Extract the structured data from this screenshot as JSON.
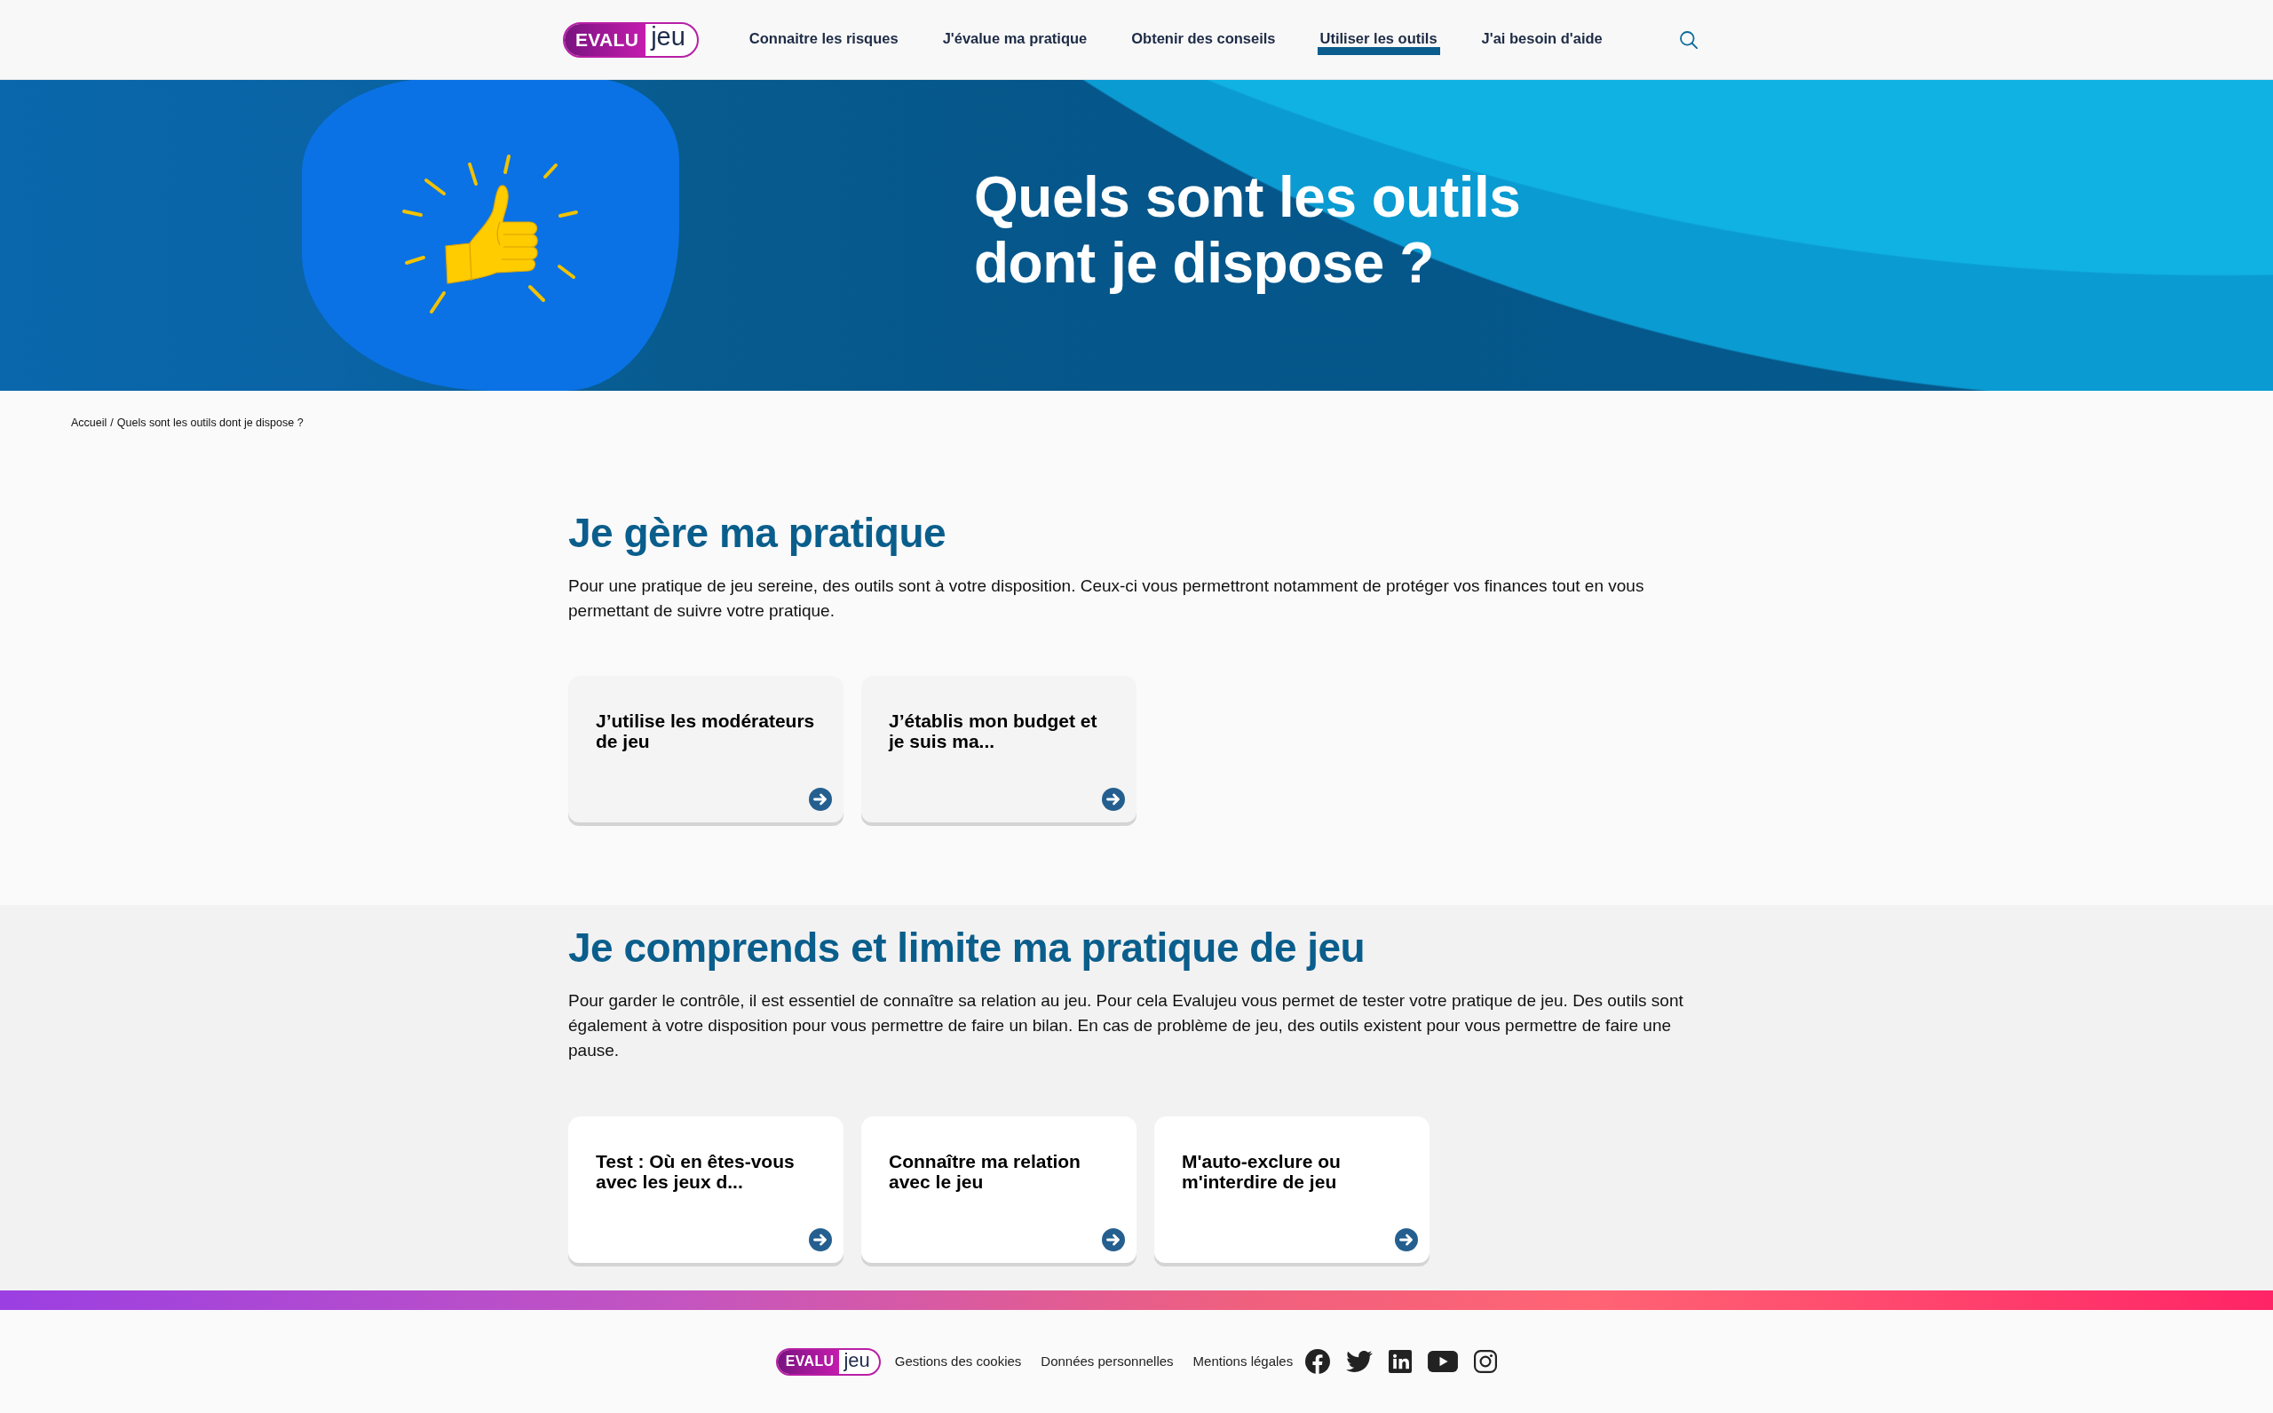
{
  "header": {
    "logo": {
      "text": "EVALU",
      "emphasis": "jeu"
    },
    "nav": [
      {
        "label": "Connaitre les risques",
        "selected": false
      },
      {
        "label": "J'évalue ma pratique",
        "selected": false
      },
      {
        "label": "Obtenir des conseils",
        "selected": false
      },
      {
        "label": "Utiliser les outils",
        "selected": true
      },
      {
        "label": "J'ai besoin d'aide",
        "selected": false
      }
    ]
  },
  "hero": {
    "title": "Quels sont les outils dont je dispose ?"
  },
  "breadcrumb": {
    "separator": "/",
    "items": [
      "Accueil",
      "Quels sont les outils dont je dispose ?"
    ]
  },
  "sections": [
    {
      "title": "Je gère ma pratique",
      "text": "Pour une pratique de jeu sereine, des outils sont à votre disposition. Ceux-ci vous permettront notamment de protéger vos finances tout en vous permettant de suivre votre pratique.",
      "cards": [
        {
          "title": "J’utilise les modérateurs de jeu"
        },
        {
          "title": "J’établis mon budget et je suis ma..."
        }
      ]
    },
    {
      "title": "Je comprends et limite ma pratique de jeu",
      "text": "Pour garder le contrôle, il est essentiel de connaître sa relation au jeu. Pour cela Evalujeu vous permet de tester votre pratique de jeu. Des outils sont également à votre disposition pour vous permettre de faire un bilan. En cas de problème de jeu, des outils existent pour vous permettre de faire une pause.",
      "cards": [
        {
          "title": "Test : Où en êtes-vous avec les jeux d..."
        },
        {
          "title": "Connaître ma relation avec le jeu"
        },
        {
          "title": "M'auto-exclure ou m'interdire de jeu"
        }
      ]
    }
  ],
  "footer": {
    "logo": {
      "text": "EVALU",
      "emphasis": "jeu"
    },
    "links": [
      "Gestions des cookies",
      "Données personnelles",
      "Mentions légales"
    ]
  }
}
